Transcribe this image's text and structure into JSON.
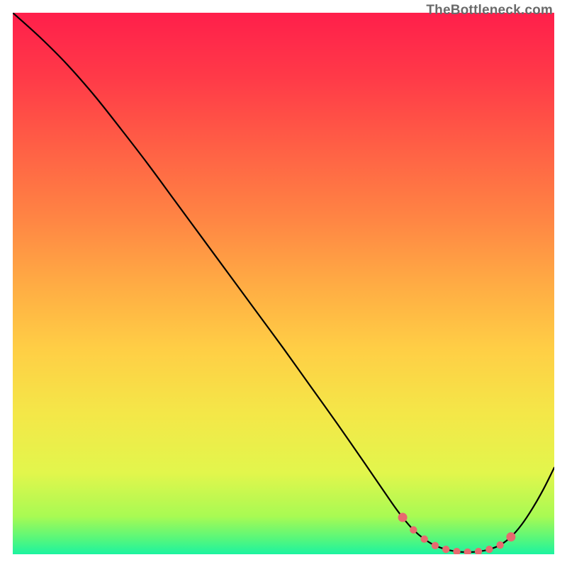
{
  "watermark": "TheBottleneck.com",
  "chart_data": {
    "type": "line",
    "title": "",
    "xlabel": "",
    "ylabel": "",
    "xlim": [
      0,
      100
    ],
    "ylim": [
      0,
      100
    ],
    "grid": false,
    "series": [
      {
        "name": "curve",
        "x": [
          0,
          5,
          10,
          15,
          20,
          25,
          30,
          35,
          40,
          45,
          50,
          55,
          60,
          65,
          70,
          72,
          74,
          76,
          78,
          80,
          82,
          84,
          86,
          88,
          90,
          92,
          94,
          96,
          98,
          100
        ],
        "y": [
          100,
          95.5,
          90.5,
          84.8,
          78.5,
          72.0,
          65.2,
          58.4,
          51.6,
          44.8,
          38.0,
          31.0,
          24.0,
          16.8,
          9.5,
          6.8,
          4.5,
          2.8,
          1.6,
          0.9,
          0.5,
          0.4,
          0.5,
          0.9,
          1.7,
          3.2,
          5.5,
          8.5,
          12.0,
          16.0
        ]
      }
    ],
    "markers": {
      "name": "min-region",
      "x": [
        72,
        74,
        76,
        78,
        80,
        82,
        84,
        86,
        88,
        90,
        92
      ],
      "y": [
        6.8,
        4.5,
        2.8,
        1.6,
        0.9,
        0.5,
        0.4,
        0.5,
        0.9,
        1.7,
        3.2
      ]
    },
    "background_gradient": {
      "stops": [
        {
          "offset": 0.0,
          "color": "#ff1f4b"
        },
        {
          "offset": 0.12,
          "color": "#ff3a48"
        },
        {
          "offset": 0.25,
          "color": "#ff6045"
        },
        {
          "offset": 0.38,
          "color": "#ff8544"
        },
        {
          "offset": 0.5,
          "color": "#ffab44"
        },
        {
          "offset": 0.62,
          "color": "#ffce45"
        },
        {
          "offset": 0.74,
          "color": "#f4e748"
        },
        {
          "offset": 0.85,
          "color": "#e2f64c"
        },
        {
          "offset": 0.93,
          "color": "#a8fa53"
        },
        {
          "offset": 0.97,
          "color": "#59f77a"
        },
        {
          "offset": 1.0,
          "color": "#1cf3a0"
        }
      ]
    }
  }
}
